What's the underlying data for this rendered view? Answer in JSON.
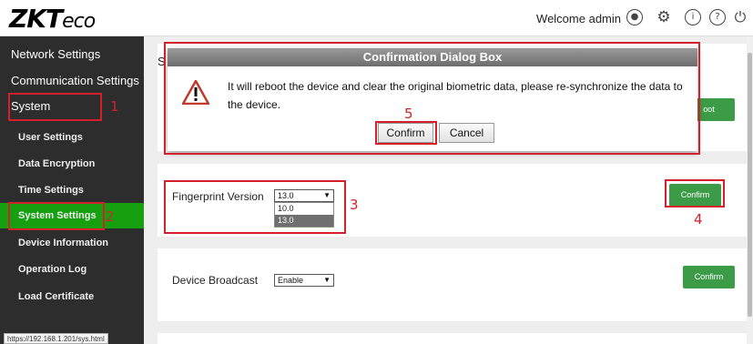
{
  "header": {
    "logo_main": "ZKT",
    "logo_eco": "eco",
    "welcome": "Welcome admin"
  },
  "icons": [
    "user-icon",
    "gear-icon",
    "info-icon",
    "help-icon",
    "power-icon",
    "warning-icon"
  ],
  "sidebar": {
    "network": "Network Settings",
    "communication": "Communication Settings",
    "system": "System",
    "items": [
      "User Settings",
      "Data Encryption",
      "Time Settings",
      "System Settings",
      "Device Information",
      "Operation Log",
      "Load Certificate"
    ],
    "active_item": "System Settings",
    "status_url": "https://192.168.1.201/sys.html"
  },
  "main": {
    "partial_title": "S",
    "partial_button": "oot",
    "fingerprint": {
      "label": "Fingerprint Version",
      "value": "13.0",
      "options": [
        "10.0",
        "13.0"
      ],
      "confirm": "Confirm"
    },
    "broadcast": {
      "label": "Device Broadcast",
      "value": "Enable",
      "confirm": "Confirm"
    }
  },
  "dialog": {
    "title": "Confirmation Dialog Box",
    "message": "It will reboot the device and clear the original biometric data, please re-synchronize the data to the device.",
    "confirm": "Confirm",
    "cancel": "Cancel"
  },
  "annotations": [
    "1",
    "2",
    "3",
    "4",
    "5"
  ],
  "colors": {
    "sidebar_bg": "#2d2d2d",
    "active_green": "#16a010",
    "button_green": "#3c9b46",
    "annotation_red": "#d4202a"
  }
}
